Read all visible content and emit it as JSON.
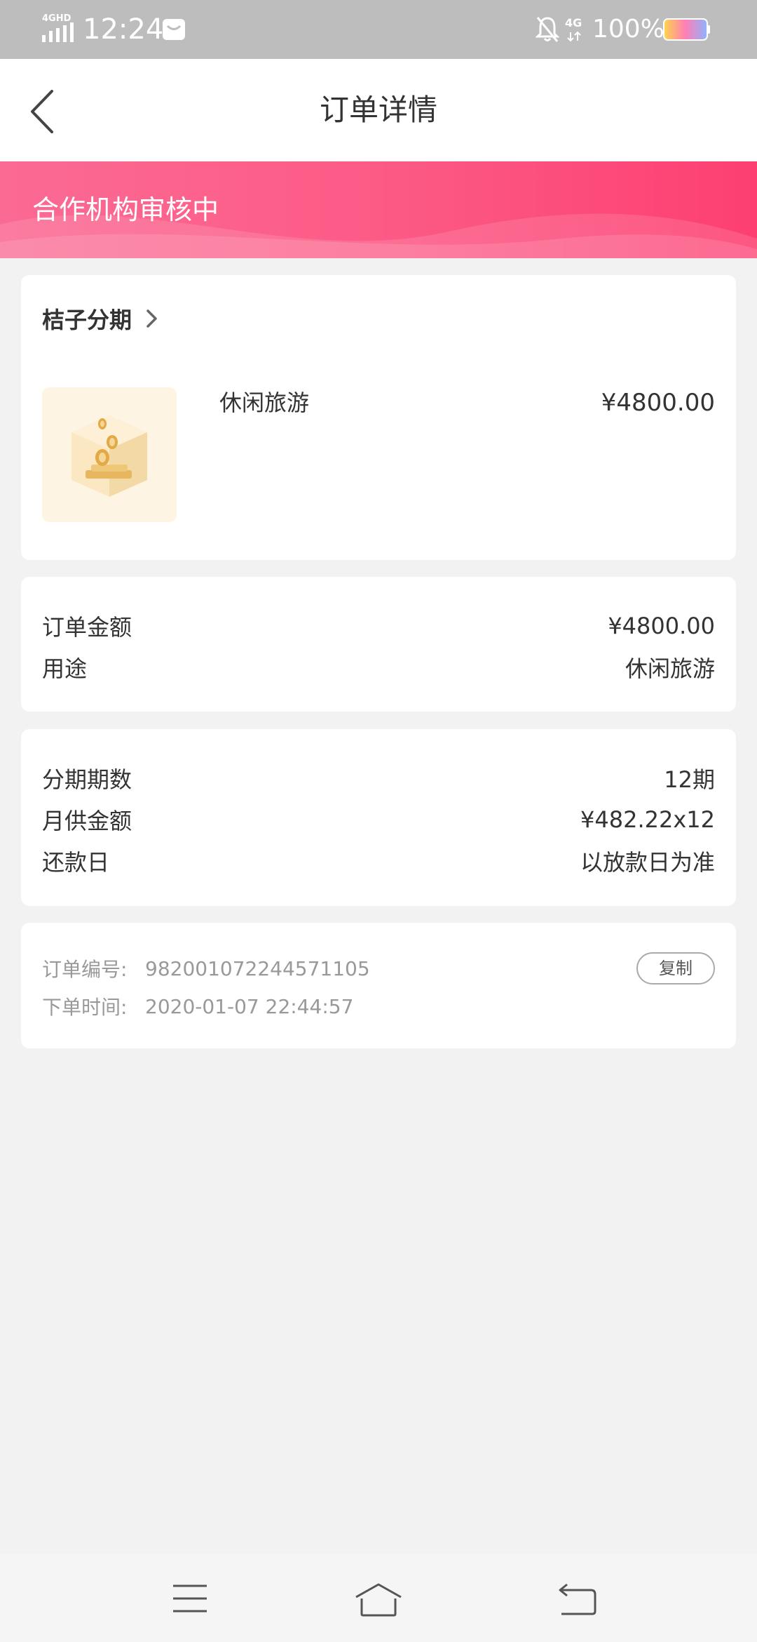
{
  "status_bar": {
    "network": "4GHD",
    "time": "12:24",
    "network2": "4G",
    "battery": "100%",
    "icons": [
      "signal-icon",
      "message-icon",
      "bell-muted-icon",
      "battery-icon"
    ]
  },
  "header": {
    "title": "订单详情",
    "back_icon": "chevron-left-icon"
  },
  "banner": {
    "status_text": "合作机构审核中",
    "colors": [
      "#fb6a93",
      "#fd3f72"
    ]
  },
  "product_card": {
    "provider": "桔子分期",
    "provider_icon": "chevron-right-icon",
    "product_name": "休闲旅游",
    "product_price": "¥4800.00",
    "thumb_icon": "coin-box-icon"
  },
  "amount_card": {
    "rows": [
      {
        "label": "订单金额",
        "value": "¥4800.00"
      },
      {
        "label": "用途",
        "value": "休闲旅游"
      }
    ]
  },
  "installment_card": {
    "rows": [
      {
        "label": "分期期数",
        "value": "12期"
      },
      {
        "label": "月供金额",
        "value": "¥482.22x12"
      },
      {
        "label": "还款日",
        "value": "以放款日为准"
      }
    ]
  },
  "order_card": {
    "order_no_label": "订单编号:",
    "order_no": "982001072244571105",
    "order_time_label": "下单时间:",
    "order_time": "2020-01-07 22:44:57",
    "copy_label": "复制"
  },
  "nav_bar": {
    "icons": [
      "menu-icon",
      "home-icon",
      "back-icon"
    ]
  }
}
